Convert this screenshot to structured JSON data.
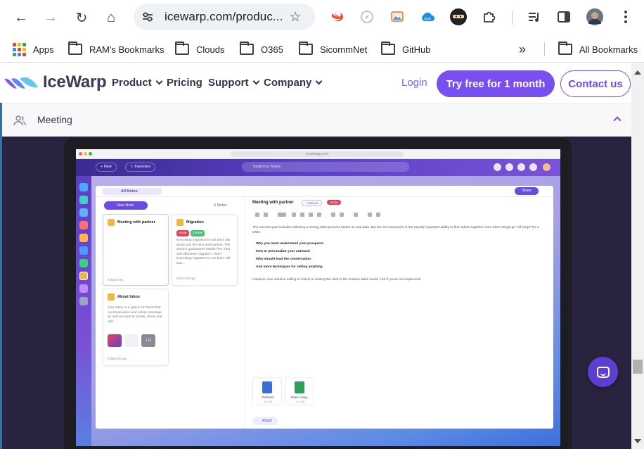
{
  "browser": {
    "url": "icewarp.com/produc...",
    "nav": {
      "back": "←",
      "forward": "→",
      "reload": "↻",
      "home": "⌂"
    },
    "icons": {
      "tune": "site-info-icon",
      "star": "bookmark-star-icon"
    },
    "extensions": [
      "swift-icon",
      "compass-icon",
      "image-icon",
      "cloud-icon",
      "ninja-icon",
      "puzzle-icon",
      "media-icon",
      "sidepanel-icon",
      "avatar",
      "menu-icon"
    ],
    "bookmarks": [
      {
        "label": "Apps",
        "icon": "apps-grid-icon"
      },
      {
        "label": "RAM's Bookmarks",
        "icon": "folder-icon"
      },
      {
        "label": "Clouds",
        "icon": "folder-icon"
      },
      {
        "label": "O365",
        "icon": "folder-icon"
      },
      {
        "label": "SicommNet",
        "icon": "folder-icon"
      },
      {
        "label": "GitHub",
        "icon": "folder-icon"
      }
    ],
    "more_label": "»",
    "all_bookmarks_label": "All Bookmarks"
  },
  "site": {
    "brand": "IceWarp",
    "nav": [
      {
        "label": "Product",
        "has_menu": true
      },
      {
        "label": "Pricing",
        "has_menu": false
      },
      {
        "label": "Support",
        "has_menu": true
      },
      {
        "label": "Company",
        "has_menu": true
      }
    ],
    "login_label": "Login",
    "try_label": "Try free for 1 month",
    "contact_label": "Contact us",
    "accent": "#7a4ff0",
    "accordion": {
      "label": "Meeting",
      "icon": "users-icon",
      "expanded": true
    }
  },
  "preview": {
    "url": "e.icewarp.com",
    "new_pill": "+ New",
    "favorites_pill": "☆ Favorites",
    "search_placeholder": "Search in Notes",
    "tab_label": "All Notes",
    "share_label": "Share",
    "new_note_label": "New Note",
    "notes_count": "5 Notes",
    "cards": [
      {
        "title": "Meeting with partner",
        "footer": "Edited now"
      },
      {
        "title": "Migration",
        "tags": [
          "Acute",
          "Central"
        ],
        "body": "Entrusting migration to our team will spare you the time and worries. The service guarantees hassle-free, fast and effortless migration. How? Entrusting migration to our team will spa...",
        "footer": "Edited 2h ago"
      },
      {
        "title": "About Inbox",
        "body": "Your inbox is a space for TeamChat communication and online meetings as well as room to create, share and edit...",
        "footer": "Edited 2h ago",
        "extra": "+12"
      }
    ],
    "editor": {
      "title": "Meeting with partner",
      "tags": [
        "+ Manual",
        "Acute"
      ],
      "intro": "The success part includes following a strong sales process based on real data. But the art component is the equally important ability to find values together even when things go \"off script\" for a while.",
      "bullets": [
        "Why you must understand your prospects",
        "How to personalize your outreach",
        "Who should lead the conversation",
        "And more techniques for selling anything"
      ],
      "outro": "However, true solution selling is critical to closing the deal in the modern sales world. And if you're not implementi",
      "attachments": [
        {
          "name": "Partners",
          "size": "3.5 KB",
          "color": "#3b6fd8",
          "letter": "D"
        },
        {
          "name": "Sales comp...",
          "size": "3.5 KB",
          "color": "#2e9e5b",
          "letter": "S"
        }
      ],
      "attach_label": "Attach"
    }
  },
  "chat": {
    "icon": "chat-icon"
  }
}
